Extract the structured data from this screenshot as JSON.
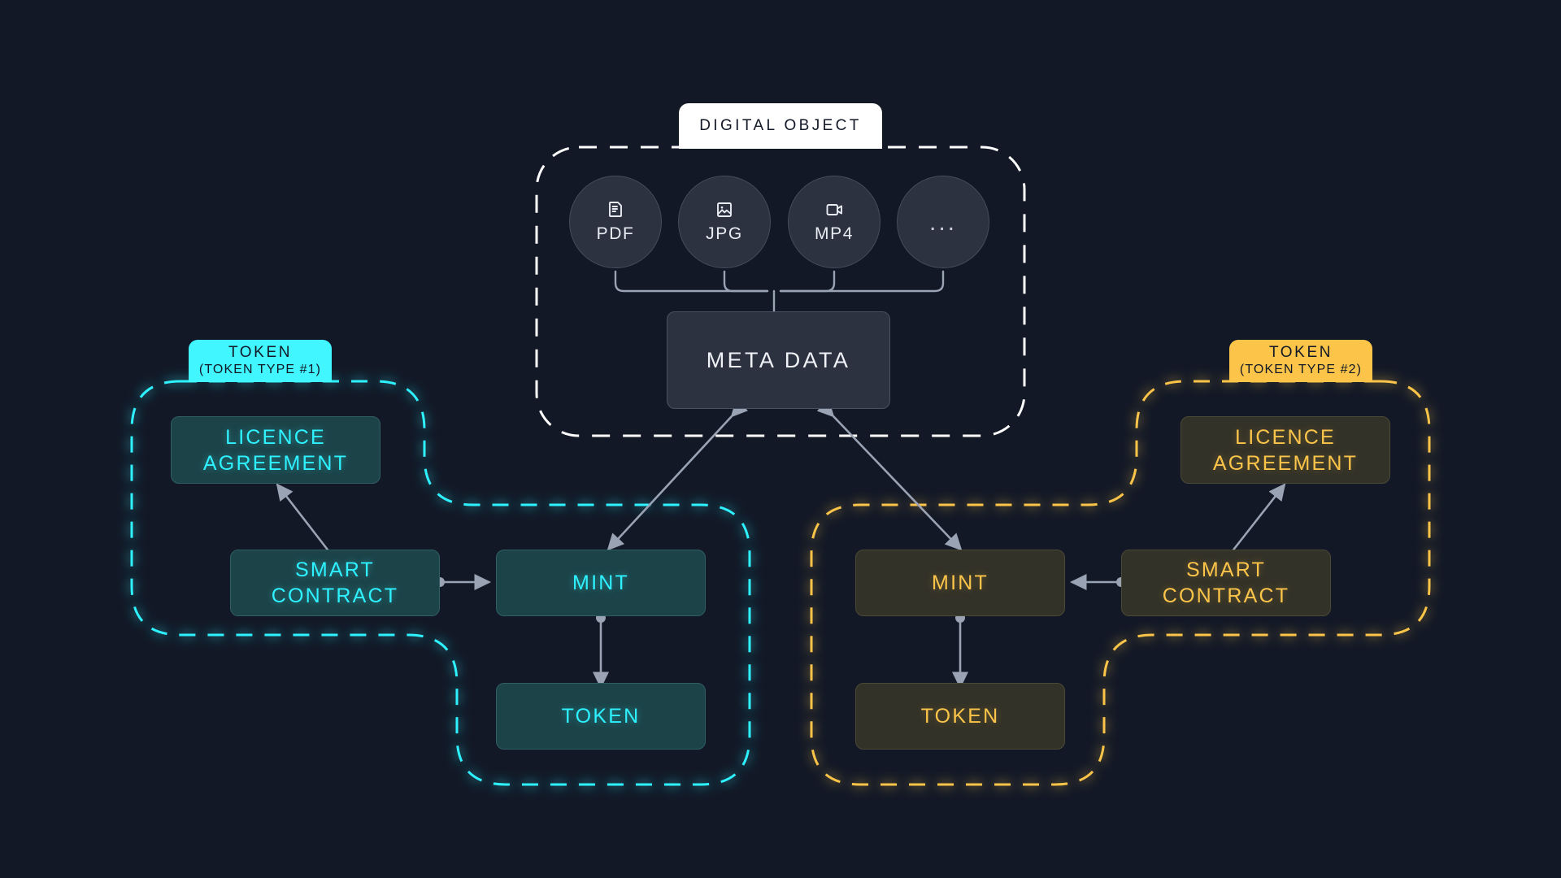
{
  "colors": {
    "background": "#121826",
    "cyan": "#2ef2ff",
    "amber": "#fcc54a",
    "white": "#ffffff",
    "connector": "#9aa3b4",
    "node_dark": "#2c3240",
    "cyan_node_fill": "#1c4348",
    "amber_node_fill": "#333228"
  },
  "digital_object": {
    "badge_label": "DIGITAL OBJECT",
    "formats": [
      {
        "label": "PDF",
        "icon": "document-icon"
      },
      {
        "label": "JPG",
        "icon": "image-icon"
      },
      {
        "label": "MP4",
        "icon": "video-icon"
      },
      {
        "label": "...",
        "icon": "ellipsis-icon"
      }
    ],
    "meta_data_label": "META DATA"
  },
  "token_groups": [
    {
      "id": "token-type-1",
      "badge_title": "TOKEN",
      "badge_subtitle": "(TOKEN TYPE #1)",
      "accent": "#2ef2ff",
      "nodes": {
        "licence": "LICENCE\nAGREEMENT",
        "licence_line1": "LICENCE",
        "licence_line2": "AGREEMENT",
        "smart_contract_line1": "SMART",
        "smart_contract_line2": "CONTRACT",
        "mint": "MINT",
        "token": "TOKEN"
      }
    },
    {
      "id": "token-type-2",
      "badge_title": "TOKEN",
      "badge_subtitle": "(TOKEN TYPE #2)",
      "accent": "#fcc54a",
      "nodes": {
        "licence_line1": "LICENCE",
        "licence_line2": "AGREEMENT",
        "smart_contract_line1": "SMART",
        "smart_contract_line2": "CONTRACT",
        "mint": "MINT",
        "token": "TOKEN"
      }
    }
  ]
}
